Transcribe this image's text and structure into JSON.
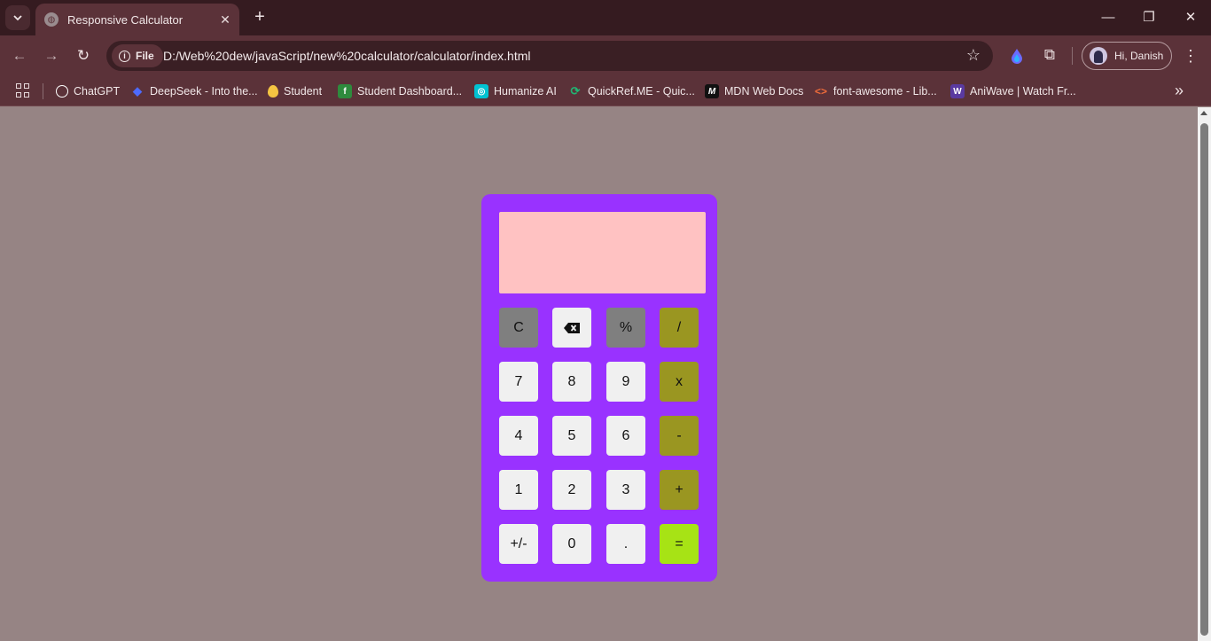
{
  "browser": {
    "tab_title": "Responsive Calculator",
    "omnibox": {
      "scheme_label": "File",
      "url": "D:/Web%20dew/javaScript/new%20calculator/calculator/index.html"
    },
    "profile_name": "Hi, Danish",
    "bookmarks": [
      {
        "label": "ChatGPT",
        "icon": "chatgpt-icon",
        "color": "#ffffff"
      },
      {
        "label": "DeepSeek - Into the...",
        "icon": "deepseek-icon",
        "color": "#4d6bfe"
      },
      {
        "label": "Student",
        "icon": "balloon-icon",
        "color": "#f4c542"
      },
      {
        "label": "Student Dashboard...",
        "icon": "leaf-icon",
        "color": "#2e8b3d"
      },
      {
        "label": "Humanize AI",
        "icon": "humanize-icon",
        "color": "#00c2d1"
      },
      {
        "label": "QuickRef.ME - Quic...",
        "icon": "quickref-icon",
        "color": "#22b573"
      },
      {
        "label": "MDN Web Docs",
        "icon": "mdn-icon",
        "color": "#111111"
      },
      {
        "label": "font-awesome - Lib...",
        "icon": "code-brackets-icon",
        "color": "#ef6c3a"
      },
      {
        "label": "AniWave | Watch Fr...",
        "icon": "aniwave-icon",
        "color": "#5a3aa0"
      }
    ]
  },
  "calculator": {
    "display_value": "",
    "colors": {
      "body": "#9932ff",
      "display": "#ffc2c2",
      "light_key": "#f0f0f0",
      "gray_key": "#7f7f7f",
      "operator_key": "#9a9621",
      "equals_key": "#a7e315"
    },
    "keys": {
      "clear": "C",
      "percent": "%",
      "divide": "/",
      "seven": "7",
      "eight": "8",
      "nine": "9",
      "multiply": "x",
      "four": "4",
      "five": "5",
      "six": "6",
      "subtract": "-",
      "one": "1",
      "two": "2",
      "three": "3",
      "add": "+",
      "toggle_sign": "+/-",
      "zero": "0",
      "decimal": ".",
      "equals": "="
    }
  }
}
